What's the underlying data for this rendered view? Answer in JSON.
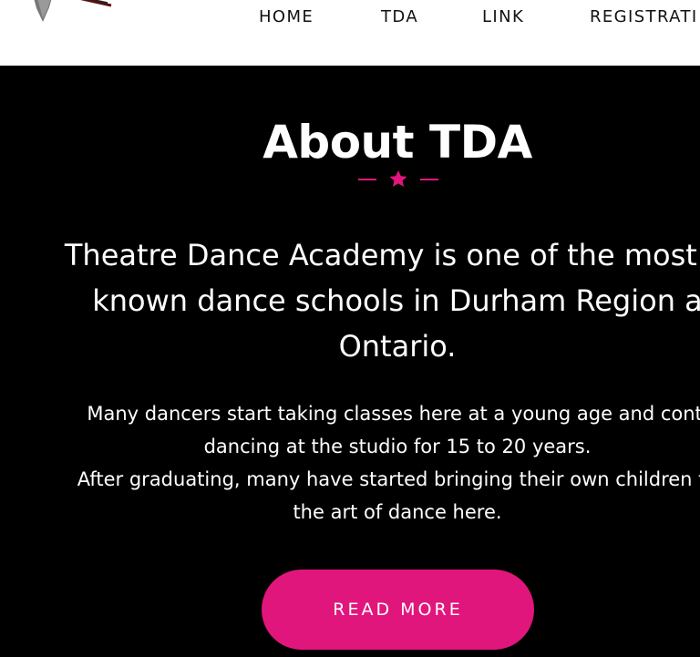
{
  "header": {
    "logo_icon": "dance-academy-logo-icon",
    "nav": [
      {
        "label": "HOME"
      },
      {
        "label": "TDA"
      },
      {
        "label": "LINK"
      },
      {
        "label": "REGISTRATI"
      }
    ]
  },
  "main": {
    "title": "About TDA",
    "divider_icon": "star-icon",
    "lead": "Theatre Dance Academy is one of the most w\nknown dance schools in Durham Region a\nOntario.",
    "body": "Many dancers start taking classes here at a young age and conti\ndancing at the studio for 15 to 20 years.\nAfter graduating, many have started bringing their own children to\nthe art of dance here.",
    "button_label": "READ MORE"
  },
  "colors": {
    "background": "#000000",
    "header_background": "#ffffff",
    "accent": "#e1167c",
    "text": "#ffffff"
  }
}
